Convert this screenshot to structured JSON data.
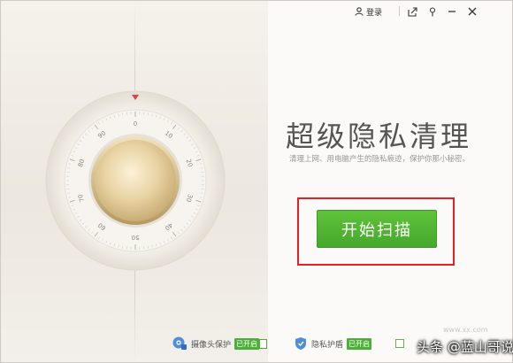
{
  "topbar": {
    "login_label": "登录"
  },
  "dial": {
    "ticks": [
      "0",
      "10",
      "20",
      "30",
      "40",
      "50",
      "60",
      "70",
      "80",
      "90"
    ]
  },
  "main": {
    "title": "超级隐私清理",
    "subtitle": "清理上网、用电脑产生的隐私痕迹，保护你那小秘密。",
    "scan_button": "开始扫描"
  },
  "bottom": {
    "camera_label": "摄像头保护",
    "camera_state": "已开启",
    "privacy_label": "隐私护盾",
    "privacy_state": "已开启"
  },
  "watermark": {
    "text": "头条 @蓝山哥说",
    "ghost": "www.xx.com"
  },
  "colors": {
    "accent_green": "#4caf38",
    "highlight_red": "#e52222",
    "title_gray": "#555555"
  }
}
